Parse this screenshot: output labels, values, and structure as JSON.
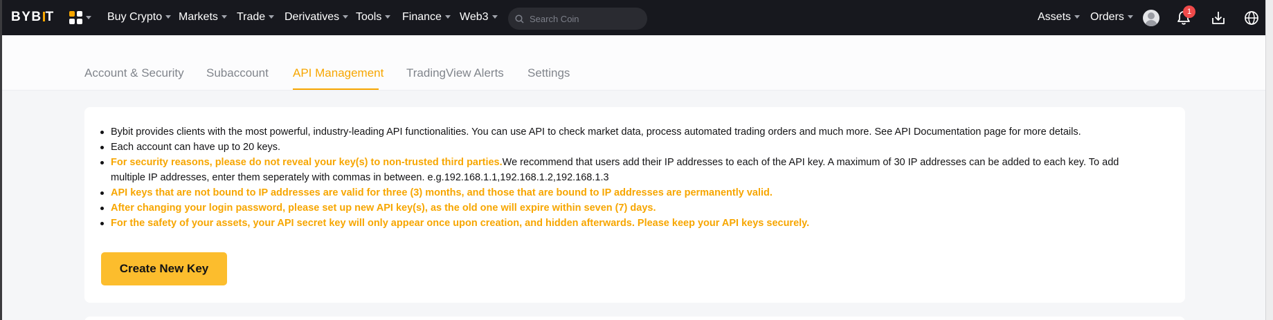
{
  "topnav": {
    "logo": "BYBIT",
    "menu": [
      {
        "label": "Buy Crypto"
      },
      {
        "label": "Markets"
      },
      {
        "label": "Trade"
      },
      {
        "label": "Derivatives"
      },
      {
        "label": "Tools"
      },
      {
        "label": "Finance"
      },
      {
        "label": "Web3"
      }
    ],
    "search_placeholder": "Search Coin",
    "assets_label": "Assets",
    "orders_label": "Orders",
    "notification_count": "1"
  },
  "tabs": [
    {
      "label": "Account & Security",
      "active": false
    },
    {
      "label": "Subaccount",
      "active": false
    },
    {
      "label": "API Management",
      "active": true
    },
    {
      "label": "TradingView Alerts",
      "active": false
    },
    {
      "label": "Settings",
      "active": false
    }
  ],
  "notes": {
    "n1": "Bybit provides clients with the most powerful, industry-leading API functionalities. You can use API to check market data, process automated trading orders and much more. See API Documentation page for more details.",
    "n2": "Each account can have up to 20 keys.",
    "n3_warn": "For security reasons, please do not reveal your key(s) to non-trusted third parties.",
    "n3_plain": "We recommend that users add their IP addresses to each of the API key. A maximum of 30 IP addresses can be added to each key. To add multiple IP addresses, enter them seperately with commas in between. e.g.192.168.1.1,192.168.1.2,192.168.1.3",
    "n4": "API keys that are not bound to IP addresses are valid for three (3) months, and those that are bound to IP addresses are permanently valid.",
    "n5": "After changing your login password, please set up new API key(s), as the old one will expire within seven (7) days.",
    "n6": "For the safety of your assets, your API secret key will only appear once upon creation, and hidden afterwards. Please keep your API keys securely."
  },
  "create_button_label": "Create New Key",
  "colors": {
    "accent": "#f7a600",
    "button": "#fcbd2d",
    "nav_bg": "#17181e",
    "badge": "#f04a4a"
  },
  "icons": [
    "apps-grid-icon",
    "search-icon",
    "avatar-icon",
    "bell-icon",
    "download-icon",
    "globe-icon"
  ]
}
